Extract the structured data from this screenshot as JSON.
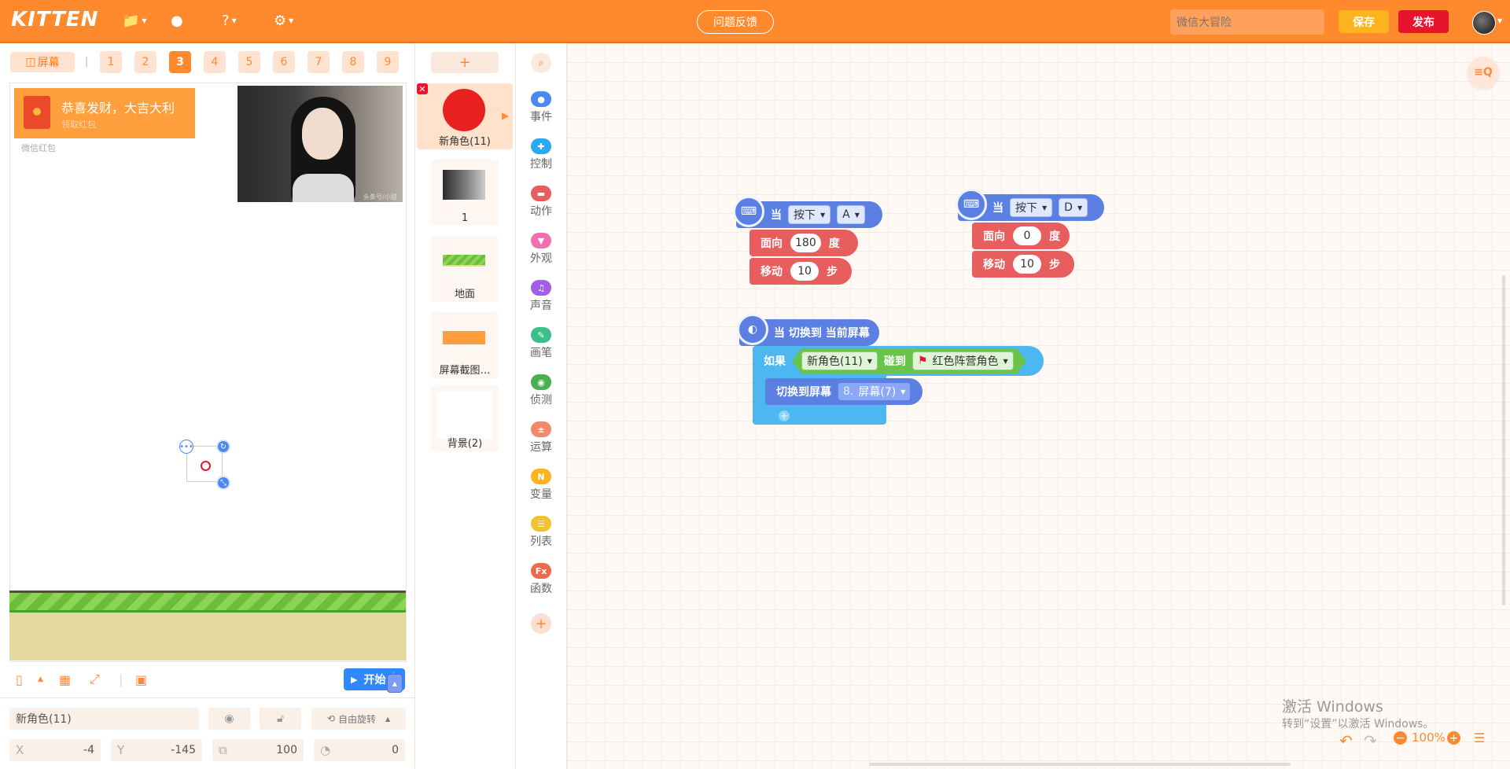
{
  "app": {
    "logo": "KITTEN"
  },
  "topbar": {
    "feedback": "问题反馈",
    "project_name": "微信大冒险",
    "save": "保存",
    "publish": "发布"
  },
  "screens": {
    "toggle": "屏幕",
    "tabs": [
      "1",
      "2",
      "3",
      "4",
      "5",
      "6",
      "7",
      "8",
      "9"
    ],
    "active": "3"
  },
  "stage": {
    "redpacket_title": "恭喜发财，大吉大利",
    "redpacket_sub": "领取红包",
    "redpacket_footer": "微信红包",
    "photo_watermark": "头条号/小甜甜"
  },
  "stage_toolbar": {
    "start": "开始"
  },
  "sprite_props": {
    "name": "新角色(11)",
    "rotate_mode": "自由旋转",
    "x_label": "X",
    "x": "-4",
    "y_label": "Y",
    "y": "-145",
    "size": "100",
    "direction": "0"
  },
  "sprites": {
    "add": "+",
    "items": [
      "新角色(11)",
      "1",
      "地面",
      "屏幕截图…",
      "背景(2)"
    ]
  },
  "categories": [
    {
      "label": "事件",
      "color": "#4d88f0"
    },
    {
      "label": "控制",
      "color": "#2ba8f0"
    },
    {
      "label": "动作",
      "color": "#e85d5d"
    },
    {
      "label": "外观",
      "color": "#f06fb0"
    },
    {
      "label": "声音",
      "color": "#a35ee8"
    },
    {
      "label": "画笔",
      "color": "#3dbf8a"
    },
    {
      "label": "侦测",
      "color": "#4caf50"
    },
    {
      "label": "运算",
      "color": "#f08a6a"
    },
    {
      "label": "变量",
      "color": "#ffb41f"
    },
    {
      "label": "列表",
      "color": "#f2c230"
    },
    {
      "label": "函数",
      "color": "#f0684a"
    }
  ],
  "blocks": {
    "keyA": {
      "when": "当",
      "press": "按下",
      "key": "A",
      "face_label": "面向",
      "face_val": "180",
      "face_unit": "度",
      "move_label": "移动",
      "move_val": "10",
      "move_unit": "步"
    },
    "keyD": {
      "when": "当",
      "press": "按下",
      "key": "D",
      "face_label": "面向",
      "face_val": "0",
      "face_unit": "度",
      "move_label": "移动",
      "move_val": "10",
      "move_unit": "步"
    },
    "screen": {
      "hat": "当 切换到 当前屏幕",
      "if": "如果",
      "sprite": "新角色(11)",
      "touch": "碰到",
      "target": "红色阵营角色",
      "switch_label": "切换到屏幕",
      "switch_num": "8.",
      "switch_val": "屏幕(7)",
      "add": "+"
    }
  },
  "workspace": {
    "zoom": "100%",
    "activate_line1": "激活 Windows",
    "activate_line2": "转到“设置”以激活 Windows。"
  }
}
